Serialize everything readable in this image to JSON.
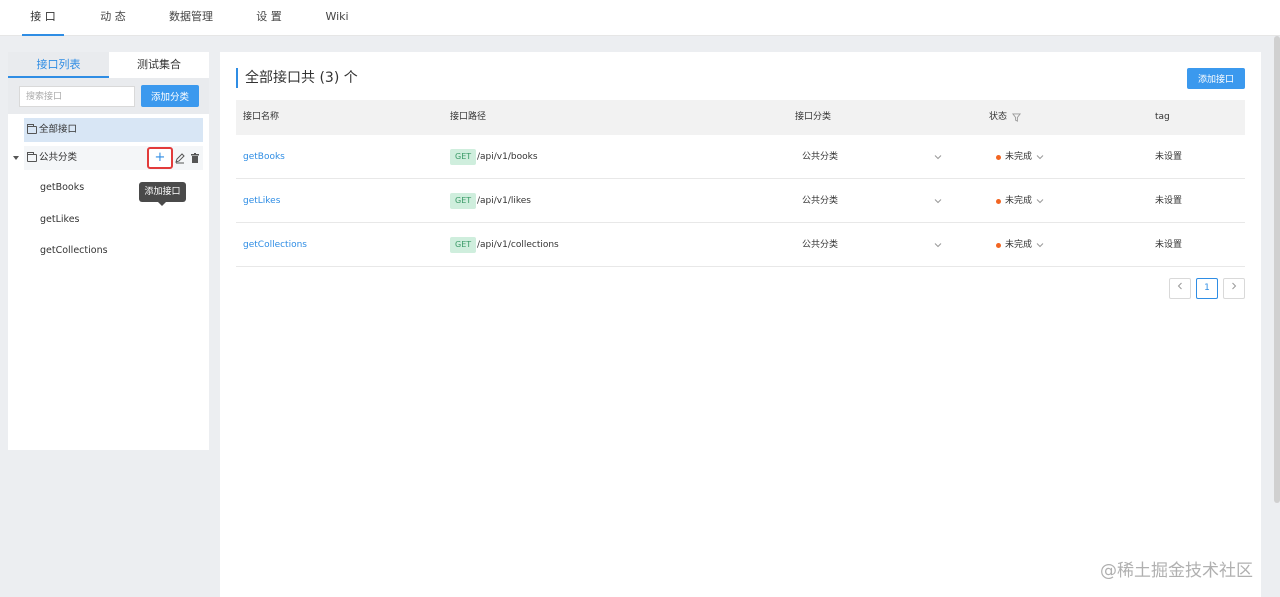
{
  "topnav": {
    "tabs": [
      {
        "label": "接 口",
        "active": true
      },
      {
        "label": "动 态",
        "active": false
      },
      {
        "label": "数据管理",
        "active": false
      },
      {
        "label": "设 置",
        "active": false
      },
      {
        "label": "Wiki",
        "active": false
      }
    ]
  },
  "sidebar": {
    "tabs": [
      "接口列表",
      "测试集合"
    ],
    "search": {
      "placeholder": "搜索接口",
      "value": ""
    },
    "add_category_label": "添加分类",
    "all_label": "全部接口",
    "category": {
      "label": "公共分类",
      "tooltip": "添加接口",
      "items": [
        "getBooks",
        "getLikes",
        "getCollections"
      ]
    }
  },
  "main": {
    "title": "全部接口共 (3) 个",
    "add_button": "添加接口",
    "columns": [
      "接口名称",
      "接口路径",
      "接口分类",
      "状态",
      "tag"
    ],
    "rows": [
      {
        "name": "getBooks",
        "method": "GET",
        "path": "/api/v1/books",
        "category": "公共分类",
        "status": "未完成",
        "tag": "未设置"
      },
      {
        "name": "getLikes",
        "method": "GET",
        "path": "/api/v1/likes",
        "category": "公共分类",
        "status": "未完成",
        "tag": "未设置"
      },
      {
        "name": "getCollections",
        "method": "GET",
        "path": "/api/v1/collections",
        "category": "公共分类",
        "status": "未完成",
        "tag": "未设置"
      }
    ],
    "pagination": {
      "current": "1"
    }
  },
  "colors": {
    "accent": "#2f8de4",
    "status_dot": "#f26522",
    "get_badge_bg": "#cfeedd"
  },
  "watermark": "@稀土掘金技术社区"
}
